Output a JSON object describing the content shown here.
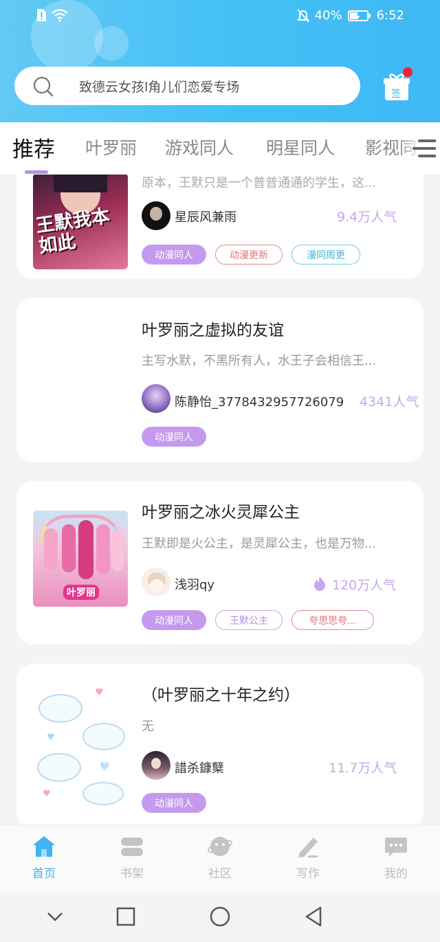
{
  "status_bar": {
    "battery": "40%",
    "time": "6:52"
  },
  "search": {
    "placeholder": "致德云女孩l角儿们恋爱专场"
  },
  "checkin": {
    "label": "签"
  },
  "tabs": [
    {
      "label": "推荐",
      "active": true
    },
    {
      "label": "叶罗丽",
      "active": false
    },
    {
      "label": "游戏同人",
      "active": false
    },
    {
      "label": "明星同人",
      "active": false
    },
    {
      "label": "影视同",
      "active": false
    }
  ],
  "cards": [
    {
      "desc": "原本，王默只是一个普普通通的学生，这...",
      "cover_text": "王默我本如此",
      "author": "星辰风兼雨",
      "popularity": "9.4万人气",
      "tags": [
        "动漫同人",
        "动漫更新",
        "漫同周更"
      ]
    },
    {
      "title": "叶罗丽之虚拟的友谊",
      "desc": "主写水默，不黑所有人，水王子会相信王...",
      "author": "陈静怡_3778432957726079",
      "popularity": "4341人气",
      "tags": [
        "动漫同人"
      ]
    },
    {
      "title": "叶罗丽之冰火灵犀公主",
      "desc": "王默即是火公主，是灵犀公主，也是万物...",
      "cover_text": "叶罗丽",
      "author": "浅羽qy",
      "popularity": "120万人气",
      "tags": [
        "动漫同人",
        "王默公主",
        "夸思思夸..."
      ]
    },
    {
      "title": "（叶罗丽之十年之约）",
      "desc": "无",
      "author": "諎杀鏮櫱",
      "popularity": "11.7万人气",
      "tags": [
        "动漫同人"
      ]
    }
  ],
  "bottom_nav": [
    {
      "label": "首页",
      "icon": "home-icon",
      "active": true
    },
    {
      "label": "书架",
      "icon": "bookshelf-icon",
      "active": false
    },
    {
      "label": "社区",
      "icon": "community-icon",
      "active": false
    },
    {
      "label": "写作",
      "icon": "write-icon",
      "active": false
    },
    {
      "label": "我的",
      "icon": "profile-icon",
      "active": false
    }
  ],
  "colors": {
    "accent": "#45c1f6",
    "tag_fill": "#c49aee",
    "popularity": "#c6a7ec"
  }
}
